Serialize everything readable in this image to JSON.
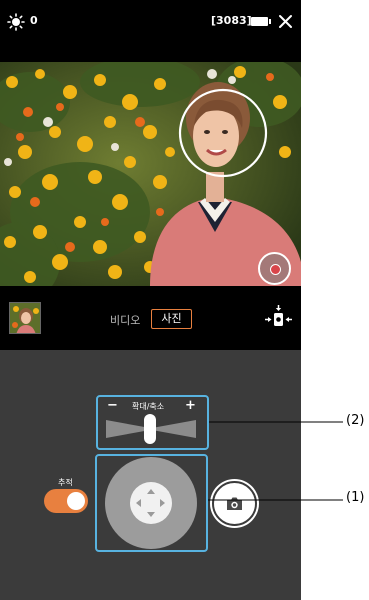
{
  "status": {
    "brightness_value": "0",
    "shots_remaining": "[3083]"
  },
  "mode": {
    "video_label": "비디오",
    "photo_label": "사진",
    "selected": "사진"
  },
  "zoom": {
    "minus": "−",
    "label": "확대/축소",
    "plus": "+"
  },
  "tracking": {
    "label": "추적",
    "on": true
  },
  "callouts": {
    "zoom": "(2)",
    "joystick": "(1)"
  },
  "colors": {
    "accent": "#e8803f",
    "callout_border": "#58b3e0",
    "panel": "#3b3b3b"
  },
  "icons": [
    "brightness-icon",
    "battery-icon",
    "close-icon",
    "camera-adjust-icon",
    "shutter-icon"
  ]
}
